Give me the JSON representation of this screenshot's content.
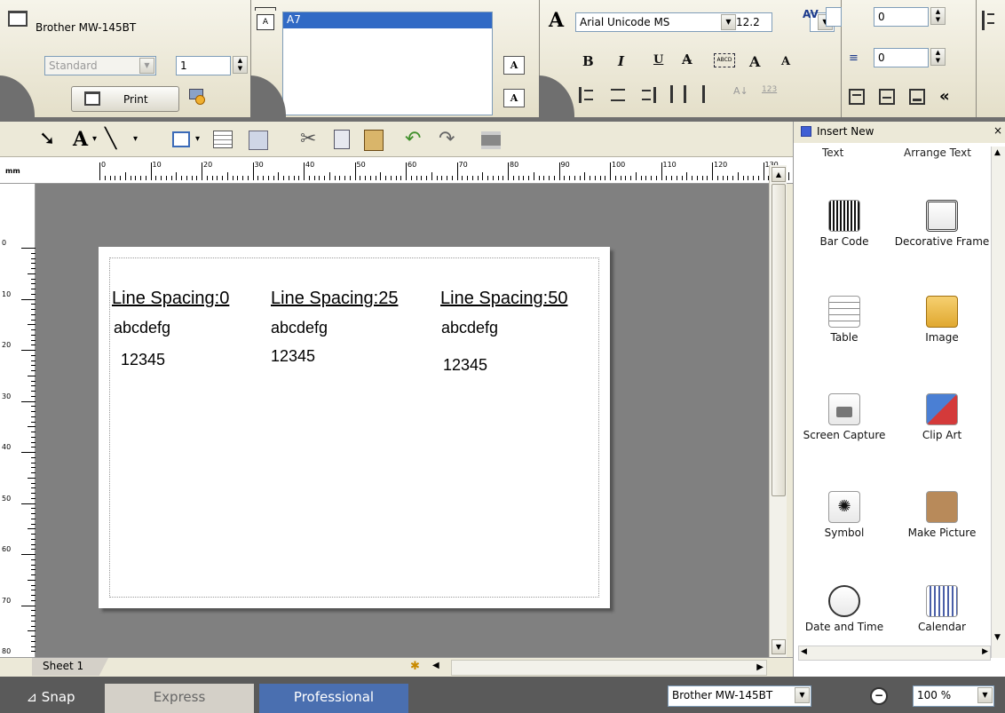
{
  "printer_panel": {
    "printer_name": "Brother MW-145BT",
    "mode_value": "Standard",
    "copies_value": "1",
    "print_label": "Print"
  },
  "layout_panel": {
    "selected_object": "A7"
  },
  "font_panel": {
    "font_name": "Arial Unicode MS",
    "font_size": "12.2",
    "bold": "B",
    "italic": "I",
    "underline": "U",
    "char_spacing_value": "0",
    "line_spacing_value": "0",
    "collapse": "«"
  },
  "canvas": {
    "columns": [
      {
        "heading": "Line Spacing:0",
        "line1": "abcdefg",
        "line2": "12345"
      },
      {
        "heading": "Line Spacing:25",
        "line1": "abcdefg",
        "line2": "12345"
      },
      {
        "heading": "Line Spacing:50",
        "line1": "abcdefg",
        "line2": "12345"
      }
    ]
  },
  "ruler": {
    "unit": "mm",
    "h_ticks": [
      "0",
      "10",
      "20",
      "30",
      "40",
      "50",
      "60",
      "70",
      "80",
      "90",
      "100",
      "110",
      "120",
      "130"
    ],
    "v_ticks": [
      "0",
      "10",
      "20",
      "30",
      "40",
      "50",
      "60",
      "70",
      "80"
    ]
  },
  "sheet_tab": "Sheet 1",
  "insert_panel": {
    "title": "Insert New",
    "tabs": [
      "Text",
      "Arrange Text"
    ],
    "items": [
      {
        "label": "Bar Code",
        "icon": "barcode-icon"
      },
      {
        "label": "Decorative Frame",
        "icon": "frame-icon"
      },
      {
        "label": "Table",
        "icon": "table-icon"
      },
      {
        "label": "Image",
        "icon": "image-icon"
      },
      {
        "label": "Screen Capture",
        "icon": "camera-icon"
      },
      {
        "label": "Clip Art",
        "icon": "clipart-icon"
      },
      {
        "label": "Symbol",
        "icon": "symbol-icon"
      },
      {
        "label": "Make Picture",
        "icon": "make-picture-icon"
      },
      {
        "label": "Date and Time",
        "icon": "clock-icon"
      },
      {
        "label": "Calendar",
        "icon": "calendar-icon"
      }
    ]
  },
  "status_bar": {
    "snap": "Snap",
    "express": "Express",
    "professional": "Professional",
    "printer": "Brother MW-145BT",
    "zoom": "100 %"
  }
}
